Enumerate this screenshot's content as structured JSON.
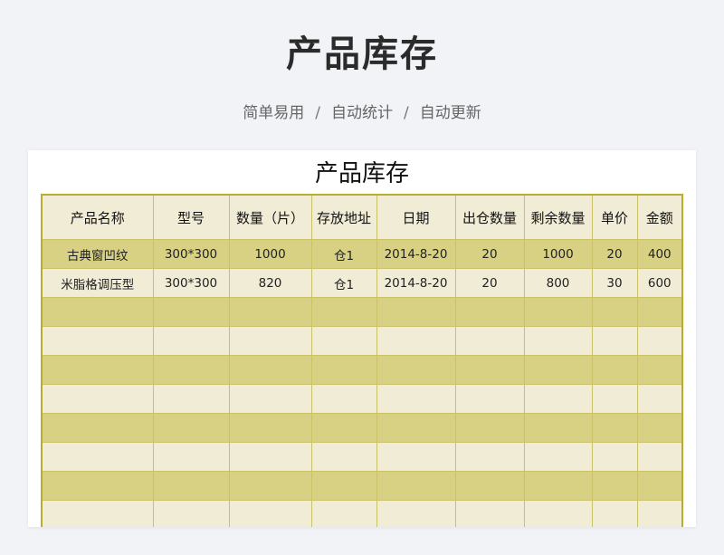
{
  "header": {
    "title": "产品库存",
    "taglines": [
      "简单易用",
      "自动统计",
      "自动更新"
    ],
    "separator": "/"
  },
  "sheet": {
    "title": "产品库存",
    "columns": [
      "产品名称",
      "型号",
      "数量（片）",
      "存放地址",
      "日期",
      "出仓数量",
      "剩余数量",
      "单价",
      "金额"
    ],
    "rows": [
      [
        "古典窗凹纹",
        "300*300",
        "1000",
        "仓1",
        "2014-8-20",
        "20",
        "1000",
        "20",
        "400"
      ],
      [
        "米脂格调压型",
        "300*300",
        "820",
        "仓1",
        "2014-8-20",
        "20",
        "800",
        "30",
        "600"
      ],
      [
        "",
        "",
        "",
        "",
        "",
        "",
        "",
        "",
        ""
      ],
      [
        "",
        "",
        "",
        "",
        "",
        "",
        "",
        "",
        ""
      ],
      [
        "",
        "",
        "",
        "",
        "",
        "",
        "",
        "",
        ""
      ],
      [
        "",
        "",
        "",
        "",
        "",
        "",
        "",
        "",
        ""
      ],
      [
        "",
        "",
        "",
        "",
        "",
        "",
        "",
        "",
        ""
      ],
      [
        "",
        "",
        "",
        "",
        "",
        "",
        "",
        "",
        ""
      ],
      [
        "",
        "",
        "",
        "",
        "",
        "",
        "",
        "",
        ""
      ],
      [
        "",
        "",
        "",
        "",
        "",
        "",
        "",
        "",
        ""
      ]
    ]
  },
  "colors": {
    "table_border": "#b7ad2e",
    "row_dark": "#d8d183",
    "row_light": "#f0ecd6",
    "page_background": "#f2f3f7"
  }
}
